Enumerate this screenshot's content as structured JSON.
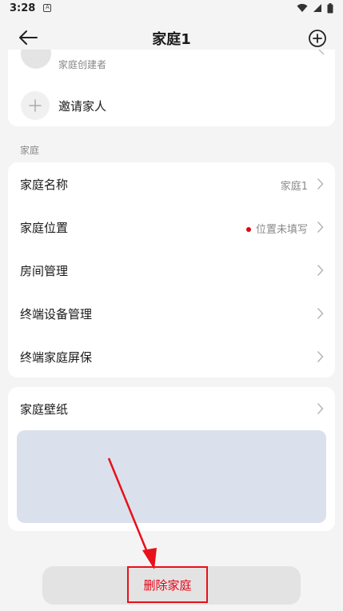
{
  "status_bar": {
    "time": "3:28",
    "notification_glyph": "A"
  },
  "header": {
    "title": "家庭1"
  },
  "members": {
    "creator_role": "家庭创建者",
    "invite_label": "邀请家人"
  },
  "section": {
    "label": "家庭"
  },
  "settings": {
    "items": [
      {
        "label": "家庭名称",
        "value": "家庭1"
      },
      {
        "label": "家庭位置",
        "value": "位置未填写"
      },
      {
        "label": "房间管理",
        "value": ""
      },
      {
        "label": "终端设备管理",
        "value": ""
      },
      {
        "label": "终端家庭屏保",
        "value": ""
      }
    ]
  },
  "wallpaper": {
    "label": "家庭壁纸"
  },
  "delete": {
    "label": "删除家庭"
  },
  "colors": {
    "accent_red": "#e60012",
    "background": "#f4f4f4",
    "wallpaper_preview": "#dbe1ec"
  }
}
